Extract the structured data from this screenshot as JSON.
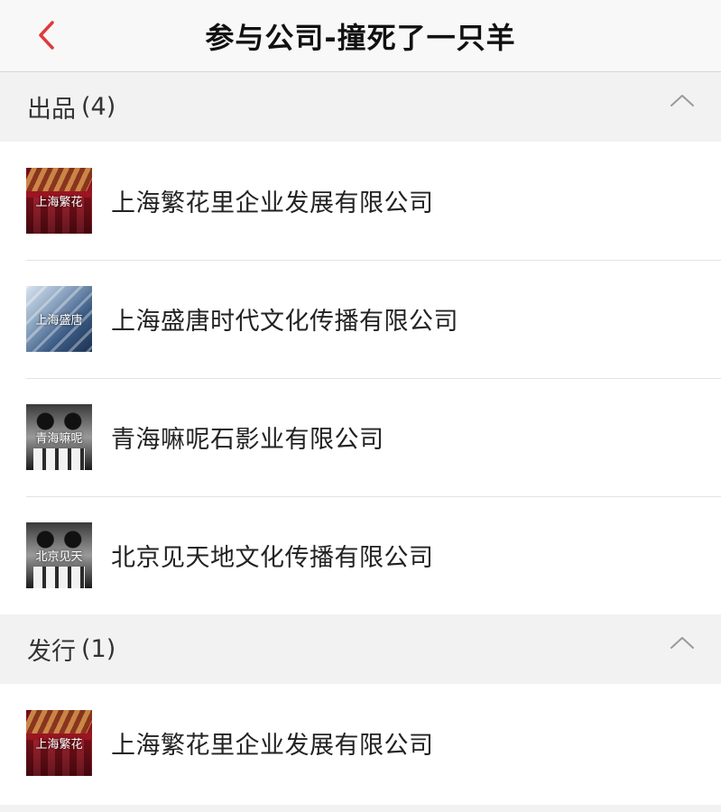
{
  "header": {
    "title": "参与公司-撞死了一只羊"
  },
  "sections": [
    {
      "label": "出品",
      "count": "(4)",
      "companies": [
        {
          "name": "上海繁花里企业发展有限公司",
          "logo_text": "上海繁花",
          "logo_style": "red"
        },
        {
          "name": "上海盛唐时代文化传播有限公司",
          "logo_text": "上海盛唐",
          "logo_style": "blue"
        },
        {
          "name": "青海嘛呢石影业有限公司",
          "logo_text": "青海嘛呢",
          "logo_style": "bw"
        },
        {
          "name": "北京见天地文化传播有限公司",
          "logo_text": "北京见天",
          "logo_style": "bw"
        }
      ]
    },
    {
      "label": "发行",
      "count": "(1)",
      "companies": [
        {
          "name": "上海繁花里企业发展有限公司",
          "logo_text": "上海繁花",
          "logo_style": "red"
        }
      ]
    }
  ],
  "colors": {
    "accent": "#e03a3a",
    "nav_background": "#f8f8f8",
    "section_background": "#f2f2f2"
  },
  "icons": {
    "back": "chevron-left-icon",
    "collapse": "chevron-up-icon"
  }
}
